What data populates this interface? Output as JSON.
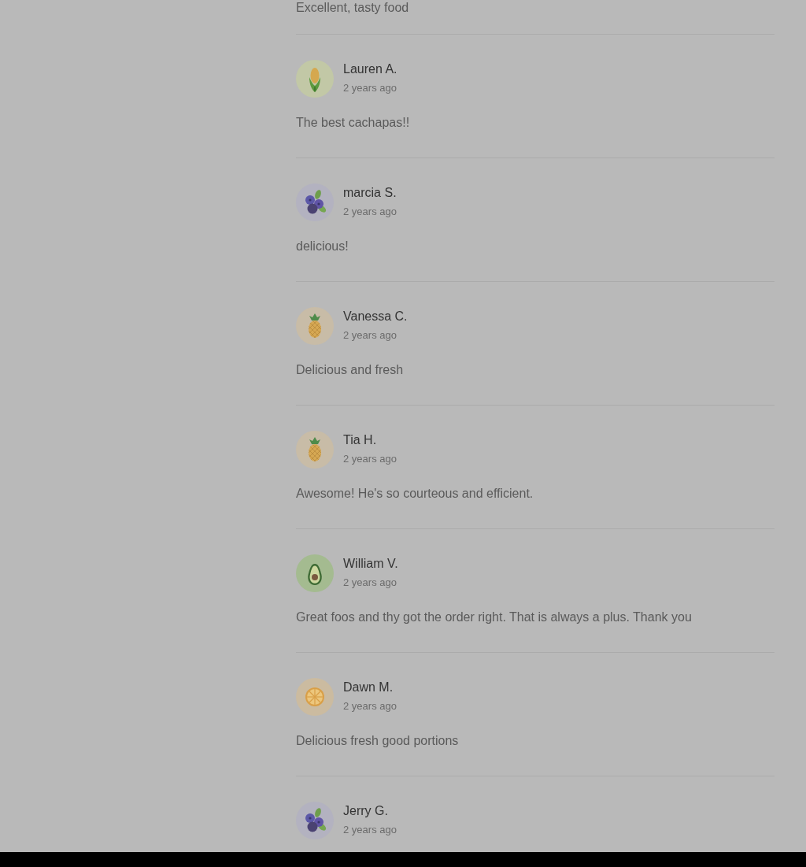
{
  "reviews": [
    {
      "comment": "Excellent, tasty food"
    },
    {
      "kind": "corn",
      "name": "Lauren A.",
      "time": "2 years ago",
      "comment": "The best cachapas!!"
    },
    {
      "kind": "blueberries",
      "name": "marcia S.",
      "time": "2 years ago",
      "comment": "delicious!"
    },
    {
      "kind": "pineapple",
      "name": "Vanessa C.",
      "time": "2 years ago",
      "comment": "Delicious and fresh"
    },
    {
      "kind": "pineapple",
      "name": "Tia H.",
      "time": "2 years ago",
      "comment": "Awesome! He's so courteous and efficient."
    },
    {
      "kind": "avocado",
      "name": "William V.",
      "time": "2 years ago",
      "comment": "Great foos and thy got the order right. That is always a plus. Thank you"
    },
    {
      "kind": "orange",
      "name": "Dawn M.",
      "time": "2 years ago",
      "comment": "Delicious fresh good portions"
    },
    {
      "kind": "blueberries",
      "name": "Jerry G.",
      "time": "2 years ago"
    }
  ]
}
